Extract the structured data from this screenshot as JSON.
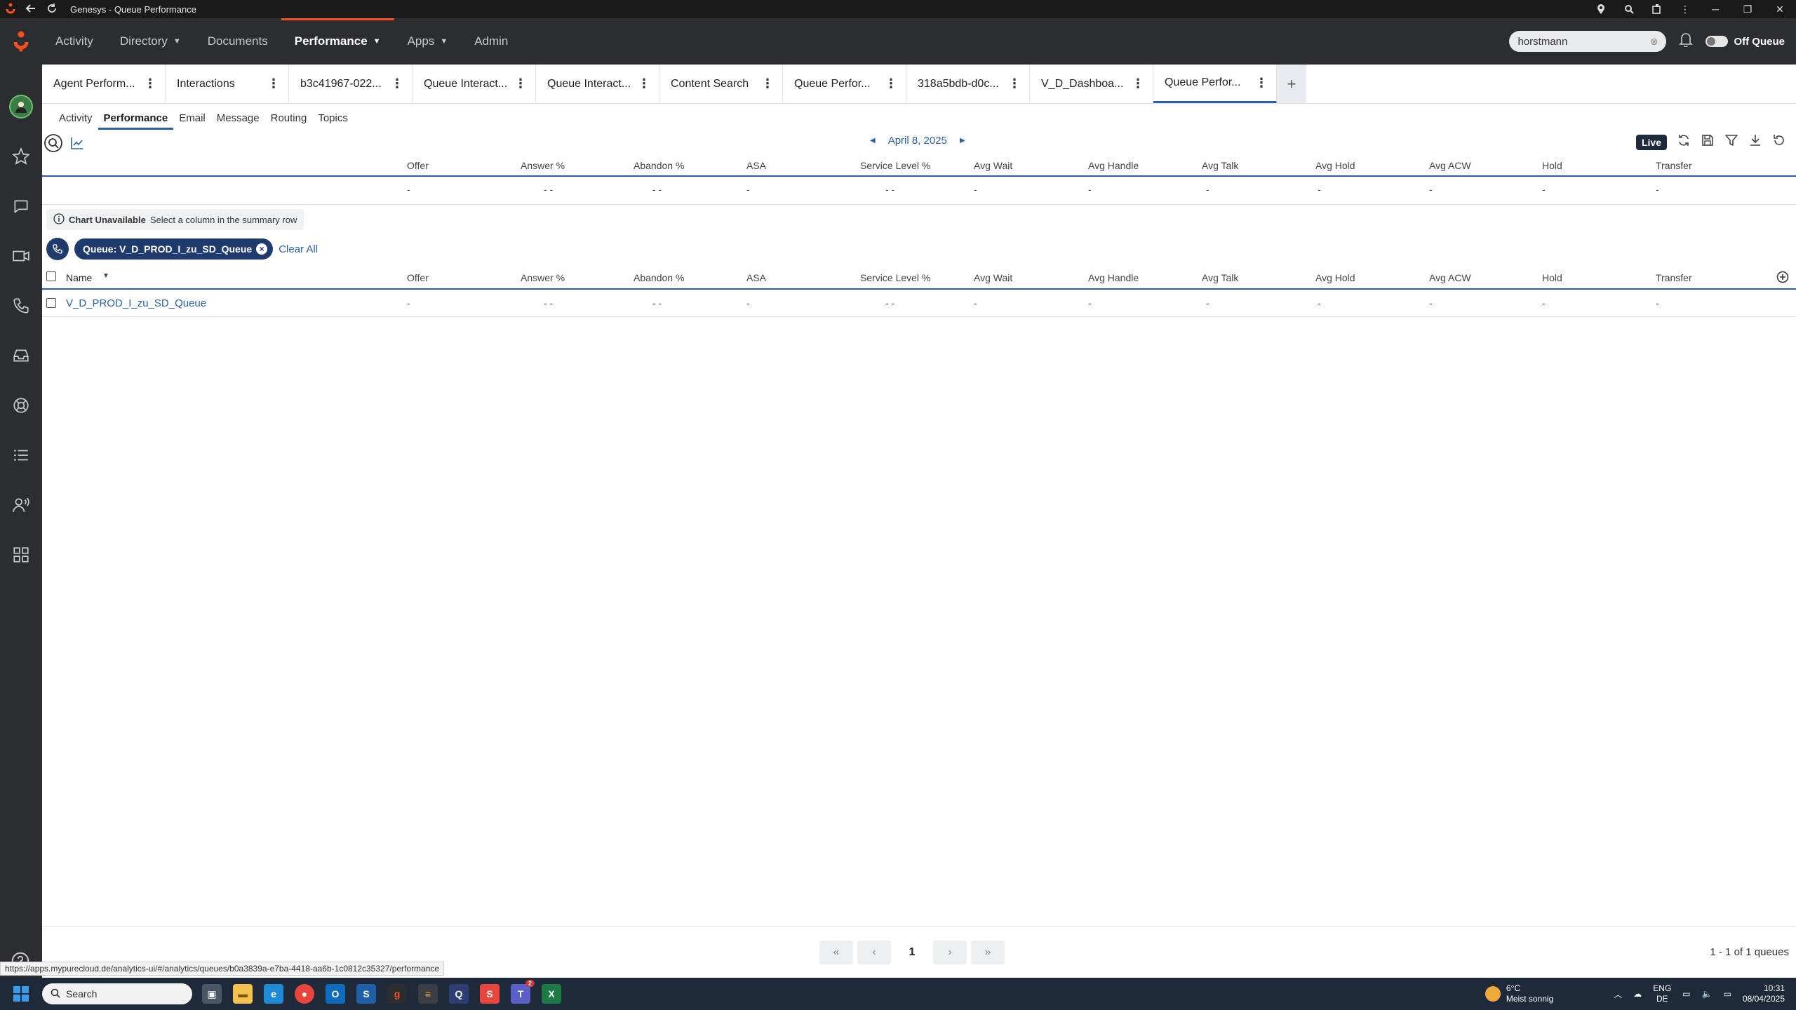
{
  "window": {
    "title": "Genesys - Queue Performance"
  },
  "nav": {
    "items": [
      {
        "label": "Activity"
      },
      {
        "label": "Directory"
      },
      {
        "label": "Documents"
      },
      {
        "label": "Performance"
      },
      {
        "label": "Apps"
      },
      {
        "label": "Admin"
      }
    ],
    "search_value": "horstmann",
    "status_label": "Off Queue"
  },
  "tabs": [
    {
      "label": "Agent Perform..."
    },
    {
      "label": "Interactions"
    },
    {
      "label": "b3c41967-022..."
    },
    {
      "label": "Queue Interact..."
    },
    {
      "label": "Queue Interact..."
    },
    {
      "label": "Content Search"
    },
    {
      "label": "Queue Perfor..."
    },
    {
      "label": "318a5bdb-d0c..."
    },
    {
      "label": "V_D_Dashboa..."
    },
    {
      "label": "Queue Perfor..."
    }
  ],
  "subtabs": [
    "Activity",
    "Performance",
    "Email",
    "Message",
    "Routing",
    "Topics"
  ],
  "toolbar": {
    "date": "April 8, 2025",
    "live_label": "Live"
  },
  "columns": [
    "Offer",
    "Answer %",
    "Abandon %",
    "ASA",
    "Service Level %",
    "Avg Wait",
    "Avg Handle",
    "Avg Talk",
    "Avg Hold",
    "Avg ACW",
    "Hold",
    "Transfer"
  ],
  "summary_values": [
    "-",
    "- -",
    "- -",
    "-",
    "- -",
    "-",
    "-",
    "-",
    "-",
    "-",
    "-",
    "-"
  ],
  "chart_note": {
    "title": "Chart Unavailable",
    "text": "Select a column in the summary row"
  },
  "filter": {
    "pill": "Queue: V_D_PROD_I_zu_SD_Queue",
    "clear_all": "Clear All"
  },
  "table": {
    "name_header": "Name",
    "rows": [
      {
        "name": "V_D_PROD_I_zu_SD_Queue",
        "values": [
          "-",
          "- -",
          "- -",
          "-",
          "- -",
          "-",
          "-",
          "-",
          "-",
          "-",
          "-",
          "-"
        ]
      }
    ]
  },
  "pagination": {
    "page": "1",
    "count": "1 - 1 of 1 queues"
  },
  "status_url": "https://apps.mypurecloud.de/analytics-ui/#/analytics/queues/b0a3839a-e7ba-4418-aa6b-1c0812c35327/performance",
  "taskbar": {
    "search_placeholder": "Search",
    "weather_temp": "6°C",
    "weather_desc": "Meist sonnig",
    "lang1": "ENG",
    "lang2": "DE",
    "time": "10:31",
    "date": "08/04/2025",
    "teams_badge": "2"
  },
  "colors": {
    "accent": "#2a60a8",
    "brand": "#ff4f1f",
    "nav_bg": "#2b2d30",
    "pill_bg": "#1f3b6e"
  }
}
